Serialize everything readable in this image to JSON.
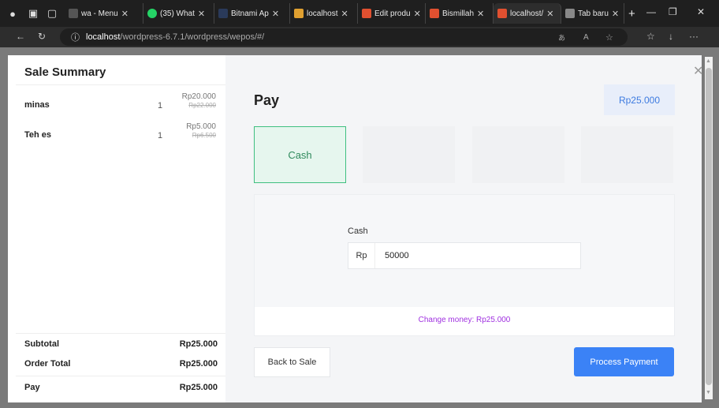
{
  "browser": {
    "tabs": [
      {
        "label": "wa - Menu",
        "color": "#555"
      },
      {
        "label": "(35) What",
        "color": "#25d366"
      },
      {
        "label": "Bitnami Ap",
        "color": "#2a3a5a"
      },
      {
        "label": "localhost",
        "color": "#e0a030"
      },
      {
        "label": "Edit produ",
        "color": "#e05030"
      },
      {
        "label": "Bismillah",
        "color": "#e05030"
      },
      {
        "label": "localhost/",
        "color": "#e05030"
      },
      {
        "label": "Tab baru",
        "color": "#888"
      }
    ],
    "url_host": "localhost",
    "url_path": "/wordpress-6.7.1/wordpress/wepos/#/"
  },
  "summary": {
    "title": "Sale Summary",
    "items": [
      {
        "name": "minas",
        "qty": "1",
        "price": "Rp20.000",
        "regular": "Rp22.000"
      },
      {
        "name": "Teh es",
        "qty": "1",
        "price": "Rp5.000",
        "regular": "Rp6.500"
      }
    ],
    "subtotal_label": "Subtotal",
    "subtotal_value": "Rp25.000",
    "order_total_label": "Order Total",
    "order_total_value": "Rp25.000",
    "pay_label": "Pay",
    "pay_value": "Rp25.000"
  },
  "pay": {
    "title": "Pay",
    "total": "Rp25.000",
    "methods": [
      "Cash",
      "",
      "",
      ""
    ],
    "cash_label": "Cash",
    "currency_prefix": "Rp",
    "cash_value": "50000",
    "change_text": "Change money: Rp25.000",
    "back_label": "Back to Sale",
    "process_label": "Process Payment"
  }
}
